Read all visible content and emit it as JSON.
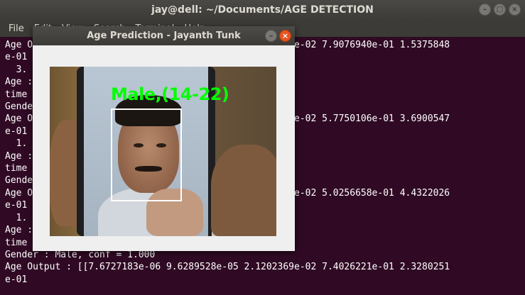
{
  "terminal": {
    "title": "jay@dell: ~/Documents/AGE DETECTION",
    "controls": {
      "minimize": "–",
      "maximize": "□",
      "close": "×"
    },
    "menu": [
      "File",
      "Edit",
      "View",
      "Search",
      "Terminal",
      "Help"
    ],
    "lines": [
      "Age Output : [[1.7460000e-05 1.6020001e-04 2.0481621e-02 7.9076940e-01 1.5375848",
      "e-01 1.7300000e-04 2.0000000e-05 1.0000000e-05]]",
      "  3.",
      "Age : 14-22, conf = 0.791",
      "time : 0.070",
      "Gender : Male, conf = 1.000",
      "Age Output : [[1.3100000e-05 1.1740001e-04 2.9917276e-02 5.7750106e-01 3.6900547",
      "e-01 2.2300000e-04 3.0000000e-05 1.0000000e-05]]",
      "  1.",
      "Age : 14-22, conf = 0.578",
      "time : 0.068",
      "Gender : Male, conf = 1.000",
      "Age Output : [[1.1700000e-05 1.0520000e-04 4.3087928e-02 5.0256658e-01 4.4322026",
      "e-01 2.5100000e-04 3.0000000e-05 1.0000000e-05]]",
      "  1.",
      "Age : 14-22, conf = 0.503",
      "time : 0.070",
      "Gender : Male, conf = 1.000",
      "Age Output : [[7.6727183e-06 9.6289528e-05 2.1202369e-02 7.4026221e-01 2.3280251",
      "e-01"
    ]
  },
  "popup": {
    "title": "Age Prediction - Jayanth Tunk",
    "controls": {
      "minimize": "–",
      "close": "×"
    },
    "prediction_label": "Male,(14-22)",
    "colors": {
      "label": "#00ff00",
      "box": "#ffffff"
    }
  }
}
